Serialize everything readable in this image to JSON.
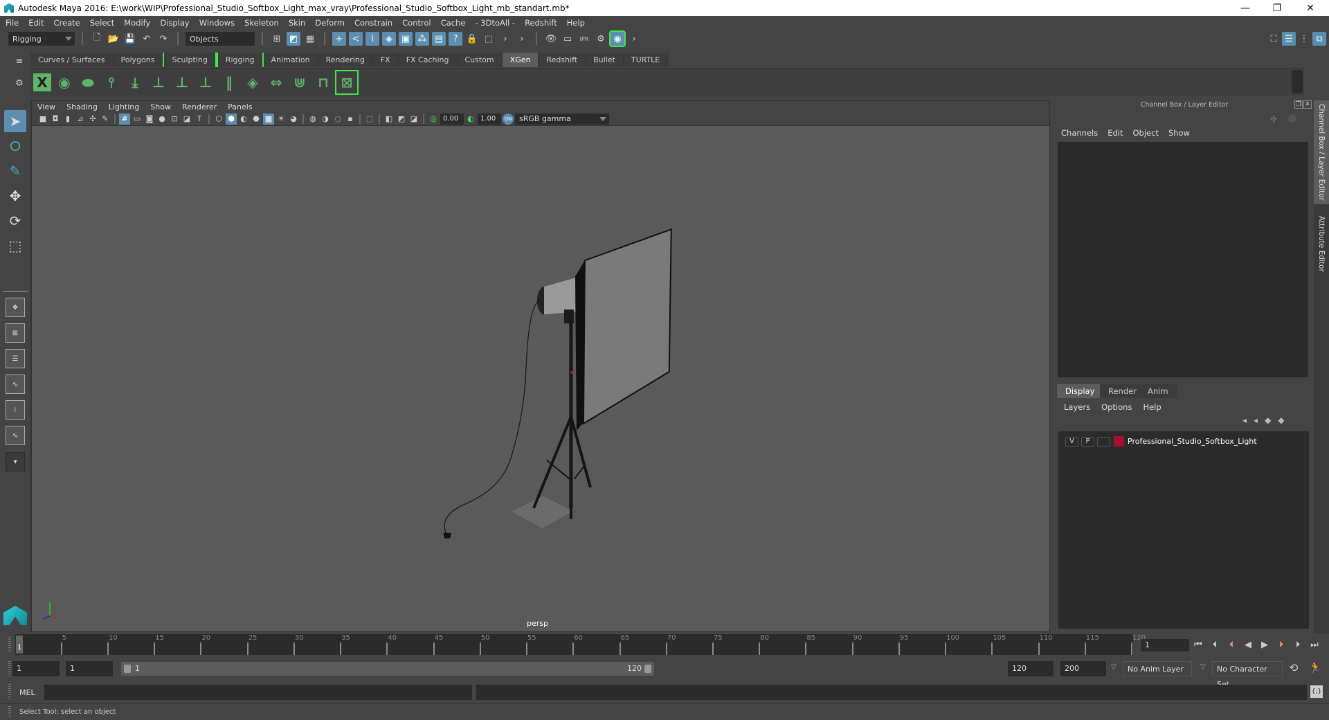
{
  "window": {
    "title": "Autodesk Maya 2016: E:\\work\\WIP\\Professional_Studio_Softbox_Light_max_vray\\Professional_Studio_Softbox_Light_mb_standart.mb*",
    "minimize": "—",
    "restore": "❐",
    "close": "✕"
  },
  "menubar": [
    "File",
    "Edit",
    "Create",
    "Select",
    "Modify",
    "Display",
    "Windows",
    "Skeleton",
    "Skin",
    "Deform",
    "Constrain",
    "Control",
    "Cache",
    "- 3DtoAll -",
    "Redshift",
    "Help"
  ],
  "statusline": {
    "menuset": "Rigging",
    "selection_mode": "Objects"
  },
  "shelf": {
    "tabs": [
      "Curves / Surfaces",
      "Polygons",
      "Sculpting",
      "Rigging",
      "Animation",
      "Rendering",
      "FX",
      "FX Caching",
      "Custom",
      "XGen",
      "Redshift",
      "Bullet",
      "TURTLE"
    ],
    "active_tab": "XGen",
    "icons": [
      "xgen-window-icon",
      "xgen-preview-icon",
      "xgen-clear-icon",
      "xgen-add-guide-icon",
      "xgen-sculpt-guide-icon",
      "xgen-add-guide-tool-icon",
      "xgen-select-guide-icon",
      "xgen-lock-guide-icon",
      "xgen-guides-icon",
      "xgen-groom-icon",
      "xgen-flip-icon",
      "xgen-brush-icon",
      "xgen-rebuild-icon",
      "xgen-delete-icon"
    ]
  },
  "viewport": {
    "menu": [
      "View",
      "Shading",
      "Lighting",
      "Show",
      "Renderer",
      "Panels"
    ],
    "exposure": "0.00",
    "gamma": "1.00",
    "color_space": "sRGB gamma",
    "camera": "persp",
    "scene_object": "Professional Studio Softbox Light"
  },
  "channel_box": {
    "title": "Channel Box / Layer Editor",
    "menu": [
      "Channels",
      "Edit",
      "Object",
      "Show"
    ]
  },
  "layer_editor": {
    "tabs": [
      "Display",
      "Render",
      "Anim"
    ],
    "active_tab": "Display",
    "menu": [
      "Layers",
      "Options",
      "Help"
    ],
    "layers": [
      {
        "visible": "V",
        "playback": "P",
        "color": "#a50f2c",
        "name": "Professional_Studio_Softbox_Light"
      }
    ]
  },
  "side_tabs": [
    "Channel Box / Layer Editor",
    "Attribute Editor"
  ],
  "timeline": {
    "ticks": [
      5,
      10,
      15,
      20,
      25,
      30,
      35,
      40,
      45,
      50,
      55,
      60,
      65,
      70,
      75,
      80,
      85,
      90,
      95,
      100,
      105,
      110,
      115,
      120
    ],
    "start": 1,
    "end": 120,
    "current_marker": "1",
    "current_frame": "1"
  },
  "range": {
    "start_time": "1",
    "playback_start": "1",
    "slider_start": "1",
    "slider_end": "120",
    "playback_end": "120",
    "end_time": "200",
    "anim_layer": "No Anim Layer",
    "character_set": "No Character Set"
  },
  "command_line": {
    "label": "MEL"
  },
  "help_line": "Select Tool: select an object"
}
